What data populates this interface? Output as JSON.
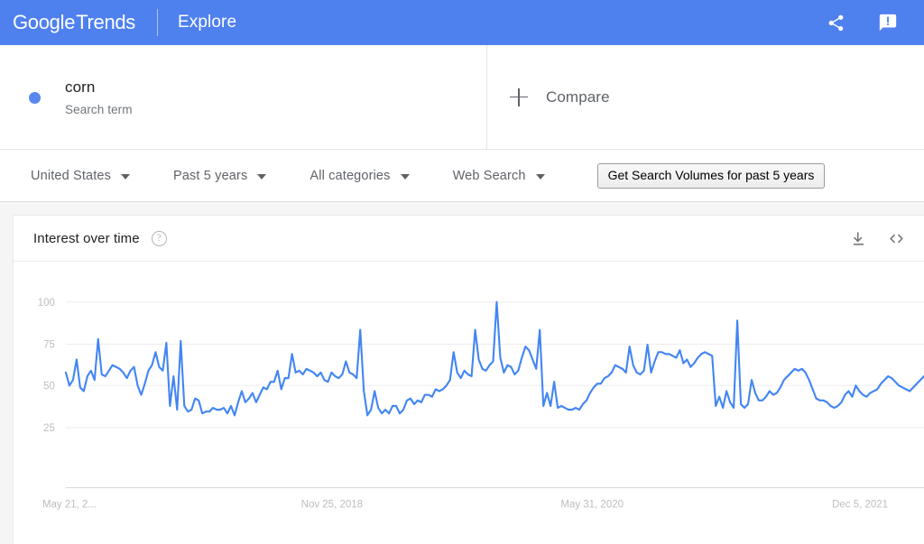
{
  "app": {
    "brand_google": "Google",
    "brand_trends": "Trends",
    "section": "Explore",
    "share_icon": "share-icon",
    "feedback_icon": "feedback-icon"
  },
  "query": {
    "term": "corn",
    "type_label": "Search term",
    "dot_color": "#5a87ee",
    "compare_label": "Compare",
    "compare_icon": "plus-icon"
  },
  "filters": [
    {
      "label": "United States",
      "name": "location"
    },
    {
      "label": "Past 5 years",
      "name": "time-range"
    },
    {
      "label": "All categories",
      "name": "category"
    },
    {
      "label": "Web Search",
      "name": "search-type"
    }
  ],
  "actions": {
    "get_volumes": "Get Search Volumes for past 5 years"
  },
  "panel": {
    "title": "Interest over time",
    "help_glyph": "?",
    "download_icon": "download-icon",
    "embed_icon": "embed-code-icon"
  },
  "colors": {
    "header_blue": "#4e80ee",
    "line_blue": "#4285f4",
    "grid_gray": "#ededed",
    "tick_gray": "#bdbdbd"
  },
  "chart_data": {
    "type": "line",
    "title": "Interest over time",
    "xlabel": "",
    "ylabel": "",
    "ylim": [
      0,
      110
    ],
    "yticks": [
      100,
      75,
      50,
      25
    ],
    "grid": true,
    "legend": false,
    "series_name": "corn",
    "x_tick_labels": [
      "May 21, 2...",
      "Nov 25, 2018",
      "May 31, 2020",
      "Dec 5, 2021"
    ],
    "x_tick_positions": [
      0,
      0.333,
      0.667,
      1.0
    ],
    "x_start": "May 21, 2017",
    "x_end": "Dec 5, 2021",
    "values": [
      62,
      55,
      58,
      69,
      54,
      52,
      60,
      63,
      58,
      80,
      61,
      60,
      63,
      66,
      65,
      64,
      62,
      59,
      63,
      65,
      55,
      50,
      56,
      63,
      66,
      73,
      65,
      63,
      78,
      44,
      60,
      42,
      79,
      44,
      41,
      42,
      48,
      47,
      40,
      41,
      41,
      43,
      42,
      42,
      43,
      40,
      44,
      39,
      46,
      52,
      46,
      48,
      51,
      46,
      50,
      54,
      53,
      57,
      57,
      63,
      53,
      59,
      59,
      72,
      62,
      63,
      61,
      64,
      63,
      62,
      60,
      62,
      58,
      57,
      62,
      60,
      59,
      61,
      68,
      62,
      61,
      59,
      85,
      52,
      39,
      42,
      52,
      43,
      40,
      42,
      40,
      44,
      44,
      40,
      42,
      47,
      48,
      45,
      47,
      46,
      50,
      50,
      49,
      53,
      52,
      53,
      55,
      58,
      73,
      62,
      59,
      63,
      61,
      60,
      85,
      69,
      64,
      63,
      66,
      68,
      100,
      70,
      62,
      66,
      65,
      61,
      63,
      70,
      76,
      74,
      69,
      64,
      85,
      44,
      51,
      44,
      57,
      43,
      44,
      43,
      42,
      42,
      43,
      42,
      45,
      47,
      51,
      54,
      56,
      56,
      59,
      60,
      62,
      66,
      65,
      64,
      62,
      76,
      66,
      62,
      61,
      63,
      77,
      62,
      68,
      73,
      73,
      72,
      72,
      71,
      70,
      74,
      67,
      69,
      65,
      67,
      70,
      72,
      73,
      72,
      71,
      44,
      49,
      43,
      52,
      46,
      43,
      90,
      45,
      43,
      45,
      58,
      51,
      47,
      47,
      49,
      52,
      50,
      51,
      54,
      58,
      60,
      62,
      64,
      63,
      64,
      62,
      58,
      53,
      48,
      47,
      47,
      46,
      44,
      43,
      44,
      46,
      50,
      52,
      49,
      55,
      52,
      50,
      49,
      51,
      52,
      53,
      56,
      58,
      60,
      59,
      57,
      55,
      54,
      53,
      52,
      54,
      56,
      58,
      60
    ]
  }
}
